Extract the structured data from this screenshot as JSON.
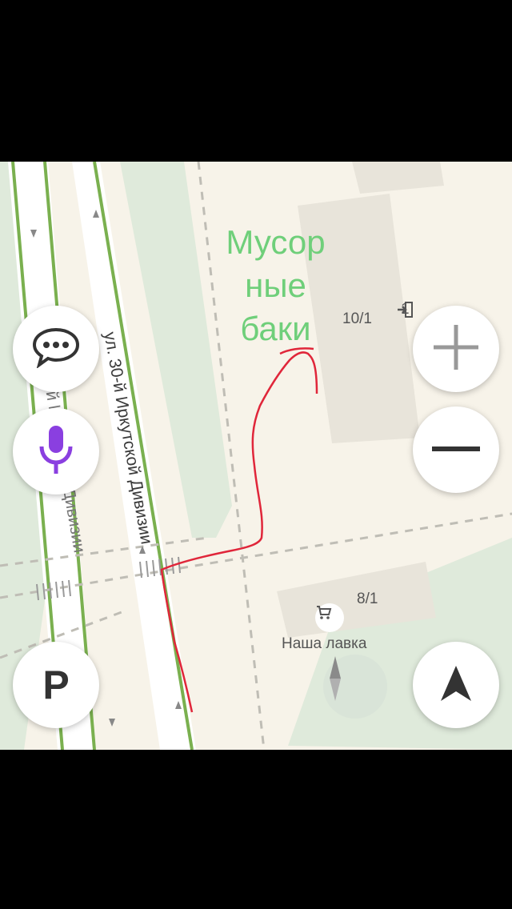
{
  "map": {
    "streets": [
      {
        "label": "ул. 30-й Иркутской Дивизии"
      },
      {
        "label": "30-й Иркутской Дивизии"
      }
    ],
    "buildings": [
      {
        "number": "10/1"
      },
      {
        "number": "8/1"
      }
    ],
    "entrance": {
      "icon": "entrance-icon",
      "label": "1"
    },
    "poi": {
      "icon": "cart-icon",
      "label": "Наша лавка"
    },
    "annotation": {
      "text_lines": [
        "Мусор",
        "ные",
        "баки"
      ],
      "color": "#6fcf7a"
    },
    "route_color": "#e0263a",
    "colors": {
      "background": "#f7f3e9",
      "park": "#dfeadb",
      "building": "#e8e4da",
      "road_edge": "#7ab04f"
    }
  },
  "controls": {
    "chat": {
      "icon": "chat-bubble-icon"
    },
    "voice": {
      "icon": "microphone-icon",
      "color": "#8a3fe0"
    },
    "zoom_in": {
      "icon": "plus-icon"
    },
    "zoom_out": {
      "icon": "minus-icon"
    },
    "parking": {
      "icon": "parking-icon",
      "label": "P"
    },
    "compass": {
      "icon": "compass-icon"
    },
    "locate": {
      "icon": "navigation-arrow-icon"
    }
  }
}
